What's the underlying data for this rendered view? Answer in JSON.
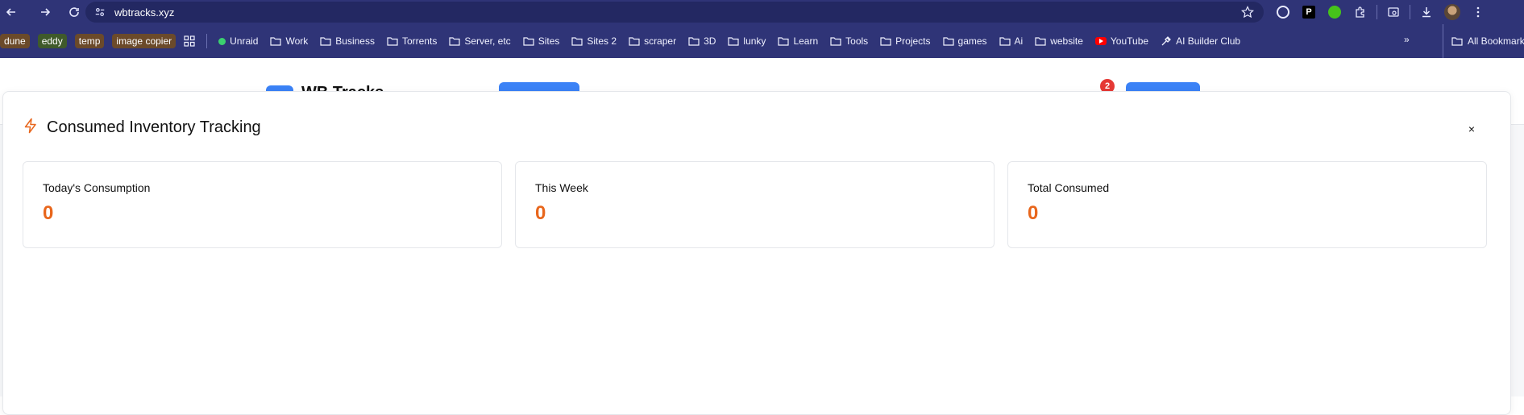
{
  "browser": {
    "url": "wbtracks.xyz",
    "bookmark_chips": [
      "dune",
      "eddy",
      "temp",
      "image copier"
    ],
    "bookmarks": [
      {
        "label": "Unraid",
        "icon": "status-dot-icon"
      },
      {
        "label": "Work",
        "icon": "folder-icon"
      },
      {
        "label": "Business",
        "icon": "folder-icon"
      },
      {
        "label": "Torrents",
        "icon": "folder-icon"
      },
      {
        "label": "Server, etc",
        "icon": "folder-icon"
      },
      {
        "label": "Sites",
        "icon": "folder-icon"
      },
      {
        "label": "Sites 2",
        "icon": "folder-icon"
      },
      {
        "label": "scraper",
        "icon": "folder-icon"
      },
      {
        "label": "3D",
        "icon": "folder-icon"
      },
      {
        "label": "lunky",
        "icon": "folder-icon"
      },
      {
        "label": "Learn",
        "icon": "folder-icon"
      },
      {
        "label": "Tools",
        "icon": "folder-icon"
      },
      {
        "label": "Projects",
        "icon": "folder-icon"
      },
      {
        "label": "games",
        "icon": "folder-icon"
      },
      {
        "label": "Ai",
        "icon": "folder-icon"
      },
      {
        "label": "website",
        "icon": "folder-icon"
      },
      {
        "label": "YouTube",
        "icon": "youtube-icon"
      },
      {
        "label": "AI Builder Club",
        "icon": "tools-icon"
      }
    ],
    "more_label": "»",
    "all_bookmarks": "All Bookmarks"
  },
  "page": {
    "brand": "WB Tracks",
    "notification_count": "2"
  },
  "modal": {
    "title": "Consumed Inventory Tracking",
    "close_label": "×",
    "cards": [
      {
        "label": "Today's Consumption",
        "value": "0"
      },
      {
        "label": "This Week",
        "value": "0"
      },
      {
        "label": "Total Consumed",
        "value": "0"
      }
    ]
  },
  "colors": {
    "browser_bar": "#2f3477",
    "accent_orange": "#e8661c",
    "button_blue": "#3b82f6"
  }
}
